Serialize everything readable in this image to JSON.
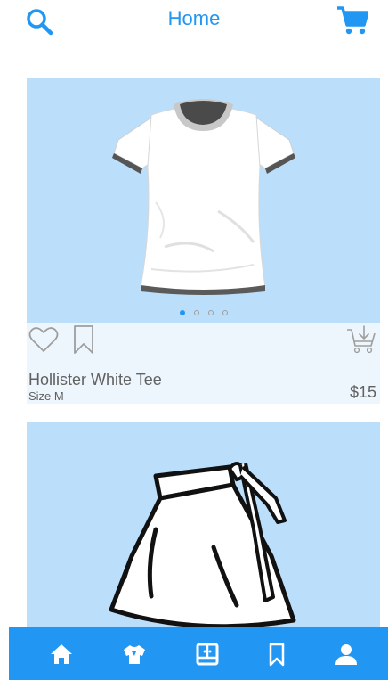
{
  "header": {
    "title": "Home",
    "search_icon": "search-icon",
    "cart_icon": "shopping-cart-icon"
  },
  "products": [
    {
      "name": "Hollister White Tee",
      "size": "Size M",
      "price": "$15",
      "image": "white-tshirt",
      "carousel_total": 4,
      "carousel_active": 1
    },
    {
      "name": "",
      "size": "",
      "price": "",
      "image": "skirt"
    }
  ],
  "tabbar": {
    "items": [
      {
        "icon": "home-icon",
        "active": true
      },
      {
        "icon": "shirt-icon",
        "active": false
      },
      {
        "icon": "wardrobe-icon",
        "active": false
      },
      {
        "icon": "bookmark-icon",
        "active": false
      },
      {
        "icon": "user-icon",
        "active": false
      }
    ]
  },
  "colors": {
    "accent": "#2196f3",
    "image_bg": "#bbdefb",
    "info_bg": "#eef6fd",
    "text": "#616161"
  }
}
